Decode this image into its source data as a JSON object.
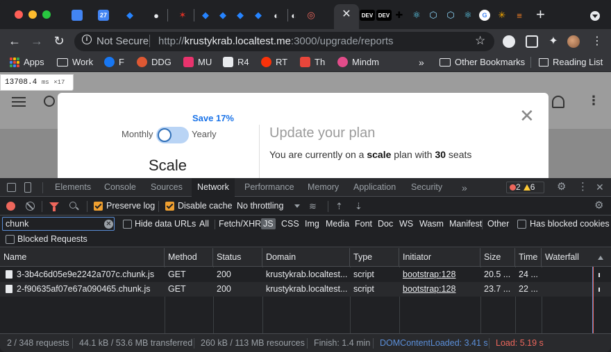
{
  "browser": {
    "tabs": [
      {
        "icon": "google-docs-icon",
        "color": "#4285f4",
        "glyph": ""
      },
      {
        "icon": "google-calendar-icon",
        "color": "#4285f4",
        "glyph": "27"
      },
      {
        "icon": "jira-icon",
        "color": "#2684ff",
        "glyph": "◆"
      },
      {
        "icon": "github-icon",
        "color": "#e8eaed",
        "glyph": "●"
      },
      {
        "icon": "custom-app-icon",
        "color": "#d93025",
        "glyph": "✶"
      },
      {
        "icon": "jira-icon",
        "color": "#2684ff",
        "glyph": "◆"
      },
      {
        "icon": "jira-icon",
        "color": "#2684ff",
        "glyph": "◆"
      },
      {
        "icon": "jira-icon",
        "color": "#2684ff",
        "glyph": "◆"
      },
      {
        "icon": "jira-icon",
        "color": "#2684ff",
        "glyph": "◆"
      },
      {
        "icon": "github-icon",
        "color": "#e8eaed",
        "glyph": "◐"
      },
      {
        "icon": "github-icon",
        "color": "#e8eaed",
        "glyph": "◐"
      },
      {
        "icon": "app-icon",
        "color": "#ee675c",
        "glyph": "◎"
      },
      {
        "icon": "dev-to-icon",
        "color": "#000000",
        "glyph": "DEV"
      },
      {
        "icon": "dev-to-icon",
        "color": "#000000",
        "glyph": "DEV"
      },
      {
        "icon": "app-icon",
        "color": "#000000",
        "glyph": "✚"
      },
      {
        "icon": "react-icon",
        "color": "#61dafb",
        "glyph": "⚛"
      },
      {
        "icon": "webpack-icon",
        "color": "#8dd6f9",
        "glyph": "⬡"
      },
      {
        "icon": "webpack-icon",
        "color": "#8dd6f9",
        "glyph": "⬡"
      },
      {
        "icon": "react-icon",
        "color": "#61dafb",
        "glyph": "⚛"
      },
      {
        "icon": "google-icon",
        "color": "#ffffff",
        "glyph": "G"
      },
      {
        "icon": "spark-icon",
        "color": "#f9ab00",
        "glyph": "✳"
      },
      {
        "icon": "stackoverflow-icon",
        "color": "#f48024",
        "glyph": "≡"
      }
    ],
    "omnibox": {
      "security": "Not Secure",
      "url_prefix": "http://",
      "url_host": "krustykrab.localtest.me",
      "url_rest": ":3000/upgrade/reports"
    },
    "bookmarks": [
      {
        "label": "Apps",
        "icon": "apps-grid-icon",
        "color": "#e8eaed"
      },
      {
        "label": "Work",
        "icon": "folder-icon",
        "color": "#e8eaed"
      },
      {
        "label": "F",
        "icon": "facebook-icon",
        "color": "#1877f2"
      },
      {
        "label": "DDG",
        "icon": "duckduckgo-icon",
        "color": "#de5833"
      },
      {
        "label": "MU",
        "icon": "mu-icon",
        "color": "#e8336d"
      },
      {
        "label": "R4",
        "icon": "r4-icon",
        "color": "#e8eaed"
      },
      {
        "label": "RT",
        "icon": "tomato-icon",
        "color": "#fa320a"
      },
      {
        "label": "Th",
        "icon": "th-icon",
        "color": "#e8463b"
      },
      {
        "label": "Mindm",
        "icon": "mindm-icon",
        "color": "#e24c8a"
      }
    ],
    "bookmarks_overflow": "»",
    "other_bookmarks": "Other Bookmarks",
    "reading_list": "Reading List"
  },
  "page": {
    "perf_counter": "13708.4",
    "perf_unit": "ms",
    "perf_multiplier": "×17",
    "modal": {
      "save_badge": "Save 17%",
      "toggle_left": "Monthly",
      "toggle_right": "Yearly",
      "plan_name": "Scale",
      "title": "Update your plan",
      "subtitle_pre": "You are currently on a ",
      "subtitle_plan": "scale",
      "subtitle_mid": " plan with ",
      "subtitle_seats": "30",
      "subtitle_post": " seats"
    }
  },
  "devtools": {
    "tabs": [
      "Elements",
      "Console",
      "Sources",
      "Network",
      "Performance",
      "Memory",
      "Application",
      "Security"
    ],
    "active_tab": "Network",
    "more_tabs": "»",
    "error_count": "2",
    "warning_count": "6",
    "toolbar": {
      "preserve_log": "Preserve log",
      "disable_cache": "Disable cache",
      "throttling": "No throttling"
    },
    "filter": {
      "value": "chunk",
      "hide_data_urls": "Hide data URLs",
      "types": [
        "All",
        "Fetch/XHR",
        "JS",
        "CSS",
        "Img",
        "Media",
        "Font",
        "Doc",
        "WS",
        "Wasm",
        "Manifest",
        "Other"
      ],
      "active_type": "JS",
      "blocked_cookies": "Has blocked cookies",
      "blocked_requests": "Blocked Requests"
    },
    "columns": [
      "Name",
      "Method",
      "Status",
      "Domain",
      "Type",
      "Initiator",
      "Size",
      "Time",
      "Waterfall"
    ],
    "rows": [
      {
        "name": "3-3b4c6d05e9e2242a707c.chunk.js",
        "method": "GET",
        "status": "200",
        "domain": "krustykrab.localtest...",
        "type": "script",
        "initiator": "bootstrap:128",
        "size": "20.5 ...",
        "time": "24 ..."
      },
      {
        "name": "2-f90635af07e67a090465.chunk.js",
        "method": "GET",
        "status": "200",
        "domain": "krustykrab.localtest...",
        "type": "script",
        "initiator": "bootstrap:128",
        "size": "23.7 ...",
        "time": "22 ..."
      }
    ],
    "status": {
      "requests": "2 / 348 requests",
      "transferred": "44.1 kB / 53.6 MB transferred",
      "resources": "260 kB / 113 MB resources",
      "finish": "Finish: 1.4 min",
      "dom_content_loaded": "DOMContentLoaded: 3.41 s",
      "load": "Load: 5.19 s"
    },
    "colors": {
      "dom": "#5b8fd9",
      "load": "#ee675c",
      "checkbox": "#f0a030"
    }
  }
}
